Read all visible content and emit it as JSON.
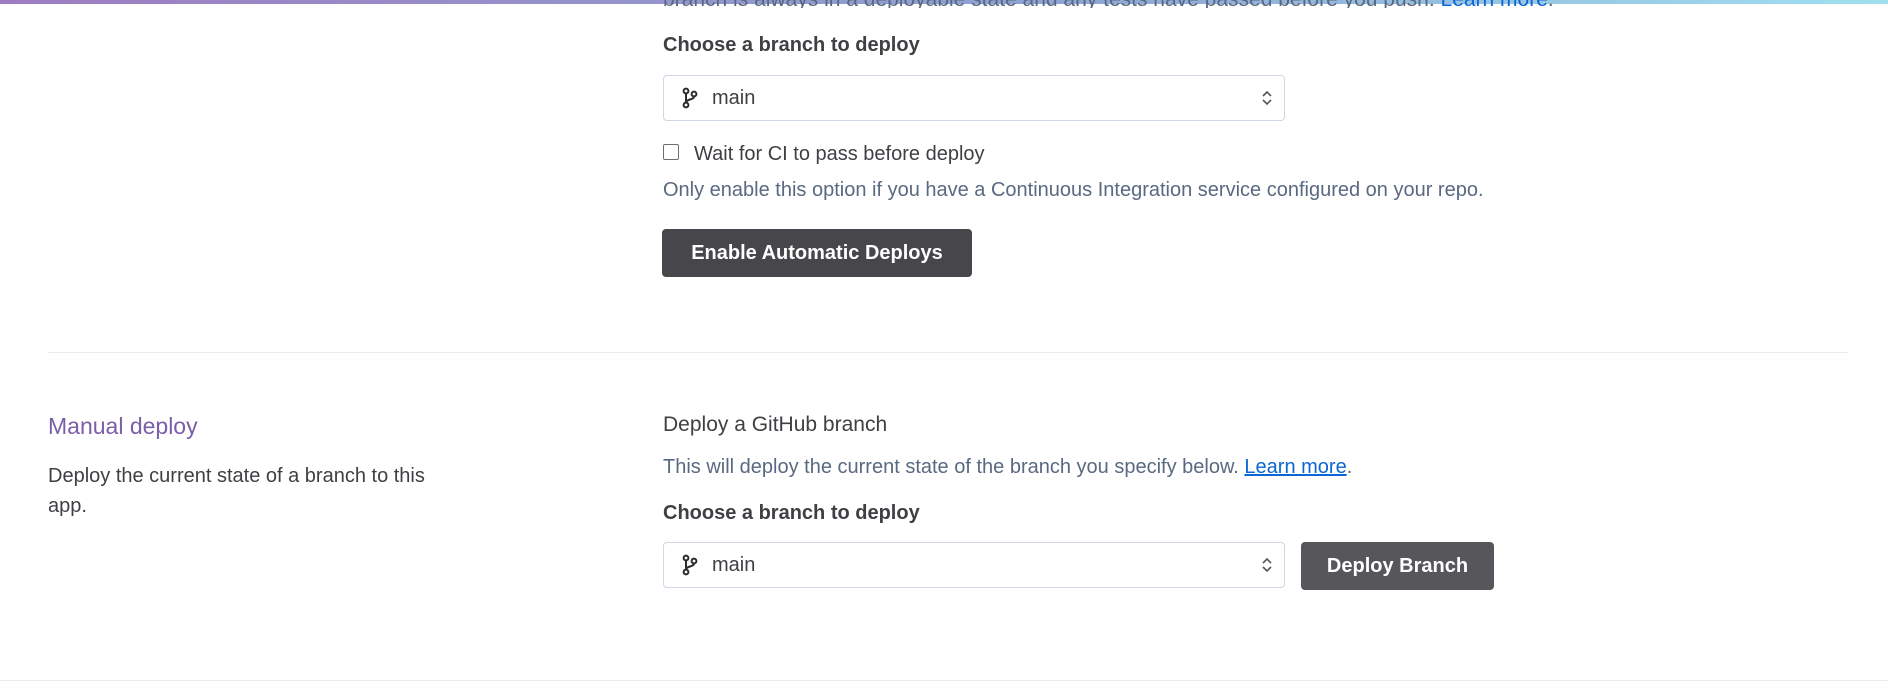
{
  "auto_deploy": {
    "intro_text_truncated": "branch is always in a deployable state and any tests have passed before you push.",
    "intro_link": "Learn more",
    "intro_link_suffix": ".",
    "branch_label": "Choose a branch to deploy",
    "branch_value": "main",
    "ci_checkbox_label": "Wait for CI to pass before deploy",
    "ci_checkbox_checked": false,
    "ci_hint": "Only enable this option if you have a Continuous Integration service configured on your repo.",
    "enable_button": "Enable Automatic Deploys"
  },
  "manual_deploy": {
    "title": "Manual deploy",
    "description": "Deploy the current state of a branch to this app.",
    "subheading": "Deploy a GitHub branch",
    "desc_text": "This will deploy the current state of the branch you specify below.",
    "desc_link": "Learn more",
    "desc_link_suffix": ".",
    "branch_label": "Choose a branch to deploy",
    "branch_value": "main",
    "deploy_button": "Deploy Branch"
  },
  "colors": {
    "accent_purple": "#7a5ea6",
    "button_dark": "#47474b",
    "link_blue": "#0b66d6",
    "muted_text": "#596981"
  },
  "icons": [
    "git-branch-icon",
    "select-chevrons-icon"
  ]
}
